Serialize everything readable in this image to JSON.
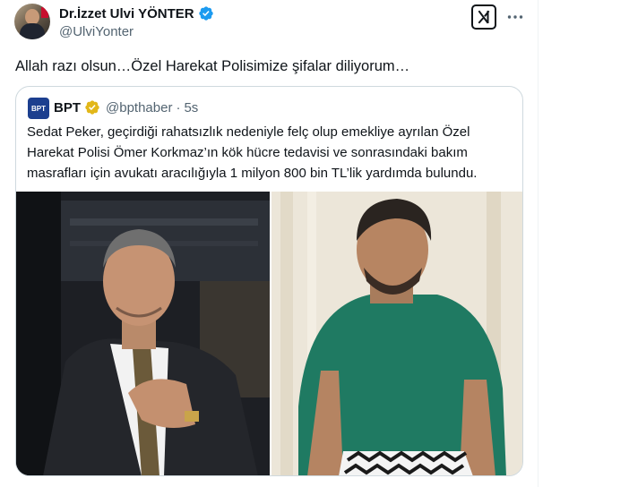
{
  "tweet": {
    "author_name": "Dr.İzzet Ulvi YÖNTER",
    "author_handle": "@UlviYonter",
    "text": "Allah razı olsun…Özel Harekat Polisimize şifalar diliyorum…",
    "verified": true
  },
  "quote": {
    "avatar_text": "BPT",
    "author_name": "BPT",
    "author_handle": "@bpthaber",
    "separator": "·",
    "time": "5s",
    "text": "Sedat Peker, geçirdiği rahatsızlık nedeniyle felç olup emekliye ayrılan Özel Harekat Polisi Ömer Korkmaz’ın kök hücre tedavisi ve sonrasındaki bakım masrafları için avukatı aracılığıyla 1 milyon 800 bin TL’lik yardımda bulundu."
  },
  "icons": {
    "verified": "verified-badge-icon",
    "gold_verified": "gold-verified-badge-icon",
    "grok": "grok-icon",
    "more": "more-icon"
  },
  "colors": {
    "verified_blue": "#1d9bf0",
    "gold": "#e2b719",
    "text": "#0f1419",
    "secondary": "#536471",
    "border": "#cfd9de"
  }
}
